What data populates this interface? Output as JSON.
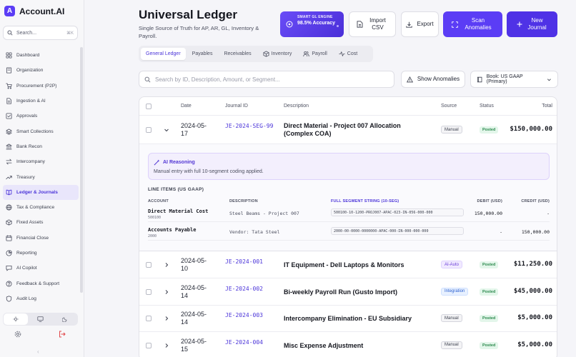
{
  "app": {
    "logo_letter": "A",
    "name": "Account.AI",
    "accent": "#5b3df5"
  },
  "sidebar": {
    "search_label": "Search...",
    "search_shortcut": "⌘K",
    "items": [
      {
        "label": "Dashboard",
        "icon": "grid-icon"
      },
      {
        "label": "Organization",
        "icon": "building-icon"
      },
      {
        "label": "Procurement (P2P)",
        "icon": "cart-icon"
      },
      {
        "label": "Ingestion & AI",
        "icon": "file-icon"
      },
      {
        "label": "Approvals",
        "icon": "check-square-icon"
      },
      {
        "label": "Smart Collections",
        "icon": "layers-icon"
      },
      {
        "label": "Bank Recon",
        "icon": "bank-icon"
      },
      {
        "label": "Intercompany",
        "icon": "exchange-icon"
      },
      {
        "label": "Treasury",
        "icon": "trend-icon"
      },
      {
        "label": "Ledger & Journals",
        "icon": "book-icon",
        "active": true
      },
      {
        "label": "Tax & Compliance",
        "icon": "globe-icon"
      },
      {
        "label": "Fixed Assets",
        "icon": "box-icon"
      },
      {
        "label": "Financial Close",
        "icon": "calendar-icon"
      },
      {
        "label": "Reporting",
        "icon": "pie-icon"
      },
      {
        "label": "AI Copilot",
        "icon": "chat-icon"
      },
      {
        "label": "Feedback & Support",
        "icon": "help-icon"
      },
      {
        "label": "Audit Log",
        "icon": "shield-icon"
      }
    ],
    "theme_options": [
      "light",
      "system",
      "dark"
    ],
    "theme_selected": "light",
    "collapse_label": "‹"
  },
  "header": {
    "title": "Universal Ledger",
    "subtitle": "Single Source of Truth for AP, AR, GL, Inventory & Payroll.",
    "ai_card": {
      "label": "SMART GL ENGINE",
      "value": "98.5% Accuracy"
    },
    "buttons": {
      "import": "Import CSV",
      "export": "Export",
      "scan": "Scan Anomalies",
      "new": "New Journal"
    }
  },
  "tabs": [
    {
      "label": "General Ledger",
      "active": true
    },
    {
      "label": "Payables"
    },
    {
      "label": "Receivables"
    },
    {
      "label": "Inventory",
      "icon": "box-icon"
    },
    {
      "label": "Payroll",
      "icon": "users-icon"
    },
    {
      "label": "Cost",
      "icon": "activity-icon"
    }
  ],
  "toolbar": {
    "search_placeholder": "Search by ID, Description, Amount, or Segment...",
    "show_anomalies": "Show Anomalies",
    "book_select": "Book: US GAAP (Primary)"
  },
  "table": {
    "columns": {
      "date": "Date",
      "journal_id": "Journal ID",
      "description": "Description",
      "source": "Source",
      "status": "Status",
      "total": "Total"
    },
    "expanded": {
      "date": "2024-05-17",
      "journal_id": "JE-2024-SEG-99",
      "description": "Direct Material - Project 007 Allocation (Complex COA)",
      "source": "Manual",
      "status": "Posted",
      "total": "$150,000.00",
      "ai_reasoning_title": "AI Reasoning",
      "ai_reasoning_text": "Manual entry with full 10-segment coding applied.",
      "line_items_title": "LINE ITEMS (US GAAP)",
      "line_headers": {
        "account": "ACCOUNT",
        "description": "DESCRIPTION",
        "segment": "FULL SEGMENT STRING (10-SEG)",
        "debit": "DEBIT (USD)",
        "credit": "CREDIT (USD)"
      },
      "lines": [
        {
          "account": "Direct Material Cost",
          "code": "500100",
          "description": "Steel Beams - Project 007",
          "segment": "500100-10-1200-PROJ007-APAC-023-IN-056-000-000",
          "debit": "150,000.00",
          "credit": "-"
        },
        {
          "account": "Accounts Payable",
          "code": "2000",
          "description": "Vendor: Tata Steel",
          "segment": "2000-00-0000-0000000-APAC-000-IN-000-000-000",
          "debit": "-",
          "credit": "150,000.00"
        }
      ]
    },
    "rows": [
      {
        "date": "2024-05-10",
        "journal_id": "JE-2024-001",
        "description": "IT Equipment - Dell Laptops & Monitors",
        "source": "AI-Auto",
        "source_kind": "ai",
        "status": "Posted",
        "total": "$11,250.00"
      },
      {
        "date": "2024-05-14",
        "journal_id": "JE-2024-002",
        "description": "Bi-weekly Payroll Run (Gusto Import)",
        "source": "Integration",
        "source_kind": "int",
        "status": "Posted",
        "total": "$45,000.00"
      },
      {
        "date": "2024-05-14",
        "journal_id": "JE-2024-003",
        "description": "Intercompany Elimination - EU Subsidiary",
        "source": "Manual",
        "source_kind": "manual",
        "status": "Posted",
        "total": "$5,000.00"
      },
      {
        "date": "2024-05-15",
        "journal_id": "JE-2024-004",
        "description": "Misc Expense Adjustment",
        "source": "Manual",
        "source_kind": "manual",
        "status": "Posted",
        "total": "$5,000.00"
      }
    ]
  }
}
